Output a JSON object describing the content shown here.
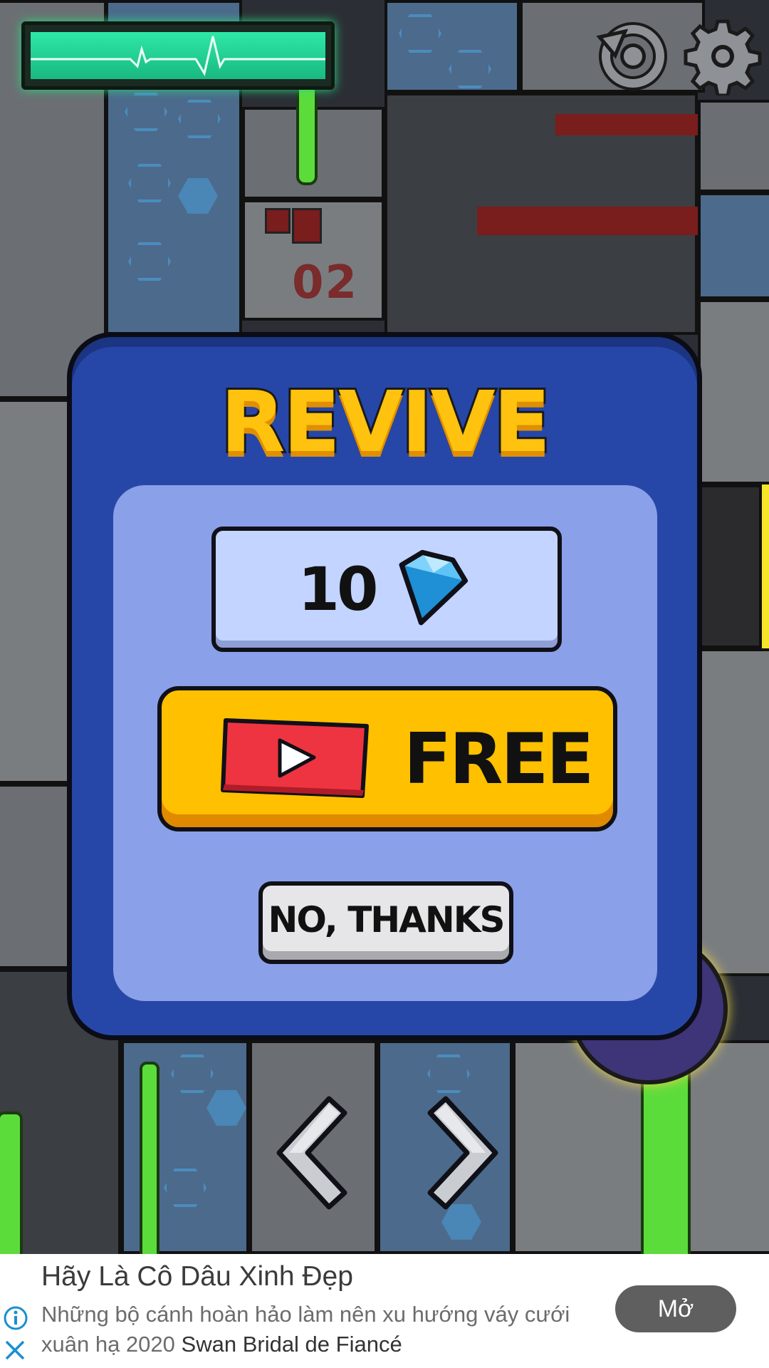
{
  "hud": {
    "heart_monitor_icon": "heartbeat-monitor-icon",
    "restart_icon": "restart-icon",
    "settings_icon": "gear-icon",
    "door_number": "02"
  },
  "dialog": {
    "title": "REVIVE",
    "gems_cost": "10",
    "gem_icon": "diamond-icon",
    "free_label": "FREE",
    "video_icon": "play-video-icon",
    "no_thanks_label": "NO, THANKS"
  },
  "navigation": {
    "left_icon": "chevron-left-icon",
    "right_icon": "chevron-right-icon"
  },
  "ad": {
    "title": "Hãy Là Cô Dâu Xinh Đẹp",
    "body": "Những bộ cánh hoàn hảo làm nên xu hướng váy cưới xuân hạ 2020",
    "brand": "Swan Bridal de Fiancé",
    "open_label": "Mở",
    "info_icon": "info-icon",
    "close_icon": "close-icon"
  },
  "colors": {
    "dialog_blue": "#2747a8",
    "inner_blue": "#8aa0e8",
    "title_yellow": "#ffc20e",
    "free_button": "#ffc000",
    "slime_green": "#5cdc3b",
    "ad_button": "#5f5f5f"
  }
}
